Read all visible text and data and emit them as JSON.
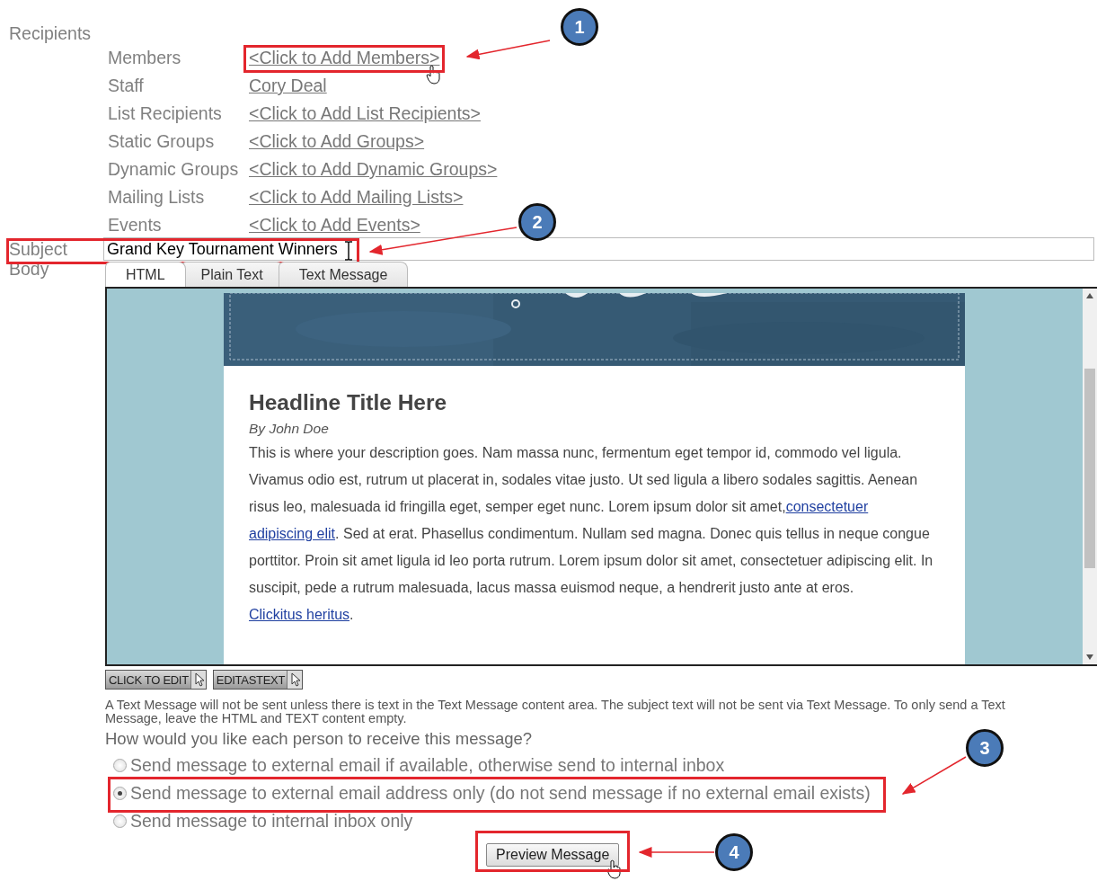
{
  "recipients": {
    "label": "Recipients",
    "rows": [
      {
        "label": "Members",
        "value": "<Click to Add Members>"
      },
      {
        "label": "Staff",
        "value": "Cory Deal"
      },
      {
        "label": "List Recipients",
        "value": "<Click to Add List Recipients>"
      },
      {
        "label": "Static Groups",
        "value": "<Click to Add Groups>"
      },
      {
        "label": "Dynamic Groups",
        "value": "<Click to Add Dynamic Groups>"
      },
      {
        "label": "Mailing Lists",
        "value": "<Click to Add Mailing Lists>"
      },
      {
        "label": "Events",
        "value": "<Click to Add Events>"
      }
    ]
  },
  "subject": {
    "label": "Subject",
    "value": "Grand Key Tournament Winners"
  },
  "body": {
    "label": "Body",
    "tabs": [
      {
        "label": "HTML",
        "selected": true
      },
      {
        "label": "Plain Text",
        "selected": false
      },
      {
        "label": "Text Message",
        "selected": false
      }
    ],
    "email": {
      "headline": "Headline Title Here",
      "byline": "By John Doe",
      "paragraph": [
        {
          "kind": "text",
          "text": "This is where your description goes. Nam massa nunc, fermentum eget tempor id, commodo vel ligula. Vivamus odio est, rutrum ut placerat in, sodales vitae justo. Ut sed ligula a libero sodales sagittis. Aenean risus leo, malesuada id fringilla eget, semper eget nunc. Lorem ipsum dolor sit amet,"
        },
        {
          "kind": "link",
          "text": "consectetuer"
        },
        {
          "kind": "link",
          "text": "adipiscing elit"
        },
        {
          "kind": "text",
          "text": ". Sed at erat. Phasellus condimentum. Nullam sed magna. Donec quis tellus in neque congue porttitor. Proin sit amet ligula id leo porta rutrum. Lorem ipsum dolor sit amet, consectetuer adipiscing elit. In suscipit, pede a rutrum malesuada, lacus massa euismod neque, a hendrerit justo ante at eros. "
        },
        {
          "kind": "link",
          "text": "Clickitus heritus"
        },
        {
          "kind": "text",
          "text": "."
        }
      ]
    },
    "edit_buttons": [
      "CLICK TO EDIT",
      "EDITASTEXT"
    ],
    "note": "A Text Message will not be sent unless there is text in the Text Message content area. The subject text will not be sent via Text Message. To only send a Text Message, leave the HTML and TEXT content empty."
  },
  "delivery": {
    "question": "How would you like each person to receive this message?",
    "options": [
      {
        "label": "Send message to external email if available, otherwise send to internal inbox",
        "selected": false
      },
      {
        "label": "Send message to external email address only (do not send message if no external email exists)",
        "selected": true
      },
      {
        "label": "Send message to internal inbox only",
        "selected": false
      }
    ]
  },
  "preview_button": "Preview Message",
  "annotations": [
    {
      "number": "1"
    },
    {
      "number": "2"
    },
    {
      "number": "3"
    },
    {
      "number": "4"
    }
  ]
}
